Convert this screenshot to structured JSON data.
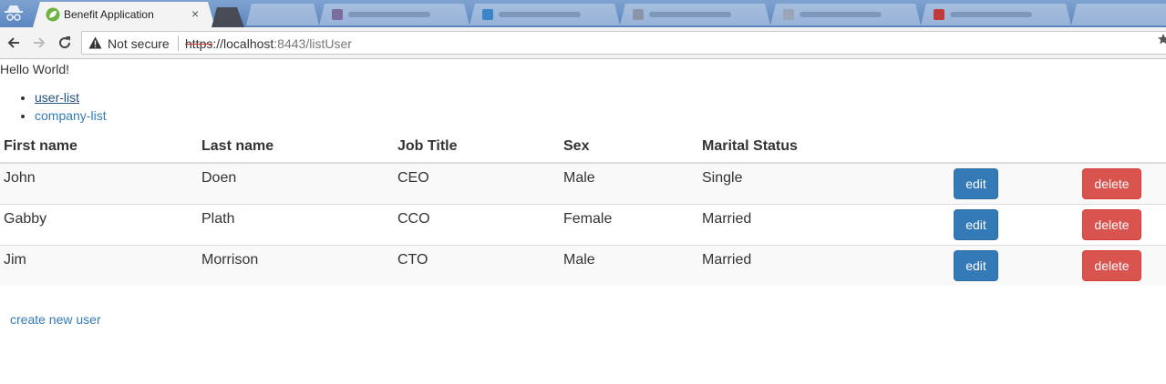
{
  "browser": {
    "active_tab": {
      "title": "Benefit Application",
      "close_glyph": "×",
      "favicon": "spring-leaf-icon"
    },
    "toolbar": {
      "security_label": "Not secure",
      "url_scheme": "https",
      "url_host": "://localhost",
      "url_rest": ":8443/listUser"
    },
    "colors": {
      "tabstrip": "#6a93c8",
      "toolbar": "#f3f3f3"
    }
  },
  "page": {
    "greeting": "Hello World!",
    "nav": [
      {
        "label": "user-list"
      },
      {
        "label": "company-list"
      }
    ],
    "table": {
      "headers": [
        "First name",
        "Last name",
        "Job Title",
        "Sex",
        "Marital Status"
      ],
      "rows": [
        {
          "first": "John",
          "last": "Doen",
          "job": "CEO",
          "sex": "Male",
          "marital": "Single"
        },
        {
          "first": "Gabby",
          "last": "Plath",
          "job": "CCO",
          "sex": "Female",
          "marital": "Married"
        },
        {
          "first": "Jim",
          "last": "Morrison",
          "job": "CTO",
          "sex": "Male",
          "marital": "Married"
        }
      ],
      "edit_label": "edit",
      "delete_label": "delete"
    },
    "create_link": "create new user",
    "colors": {
      "primary": "#337ab7",
      "danger": "#d9534f",
      "striped_row": "#f9f9f9"
    }
  }
}
